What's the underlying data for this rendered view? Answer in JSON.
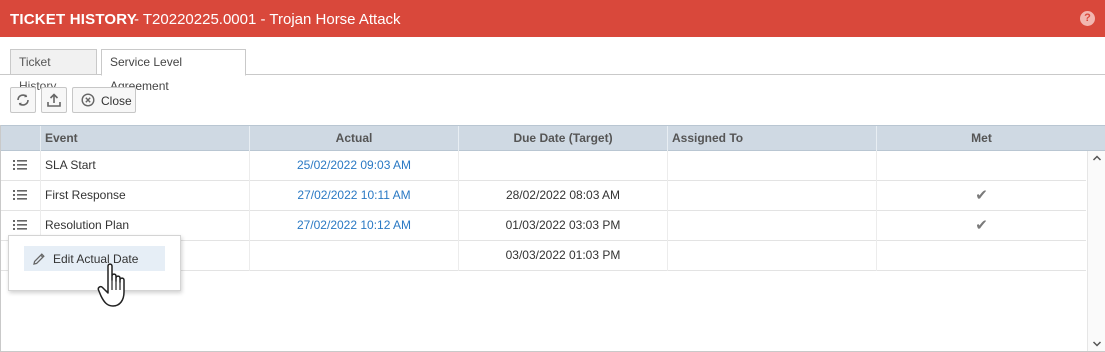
{
  "window": {
    "title": "TICKET HISTORY",
    "subtitle": "- T20220225.0001 - Trojan Horse Attack",
    "help_icon": "?"
  },
  "tabs": [
    {
      "label": "Ticket History",
      "active": false
    },
    {
      "label": "Service Level Agreement",
      "active": true
    }
  ],
  "toolbar": {
    "refresh_icon": "refresh-icon",
    "export_icon": "export-icon",
    "close_label": "Close"
  },
  "grid": {
    "columns": [
      "Event",
      "Actual",
      "Due Date (Target)",
      "Assigned To",
      "Met"
    ],
    "rows": [
      {
        "event": "SLA Start",
        "actual": "25/02/2022 09:03 AM",
        "due": "",
        "assigned": "",
        "met": ""
      },
      {
        "event": "First Response",
        "actual": "27/02/2022 10:11 AM",
        "due": "28/02/2022 08:03 AM",
        "assigned": "",
        "met": "✔"
      },
      {
        "event": "Resolution Plan",
        "actual": "27/02/2022 10:12 AM",
        "due": "01/03/2022 03:03 PM",
        "assigned": "",
        "met": "✔"
      },
      {
        "event": "",
        "actual": "",
        "due": "03/03/2022 01:03 PM",
        "assigned": "",
        "met": ""
      }
    ]
  },
  "context_menu": {
    "item_label": "Edit Actual Date"
  },
  "colors": {
    "titlebar": "#d9483b",
    "header": "#cfd9e3",
    "link": "#2a79c4"
  }
}
